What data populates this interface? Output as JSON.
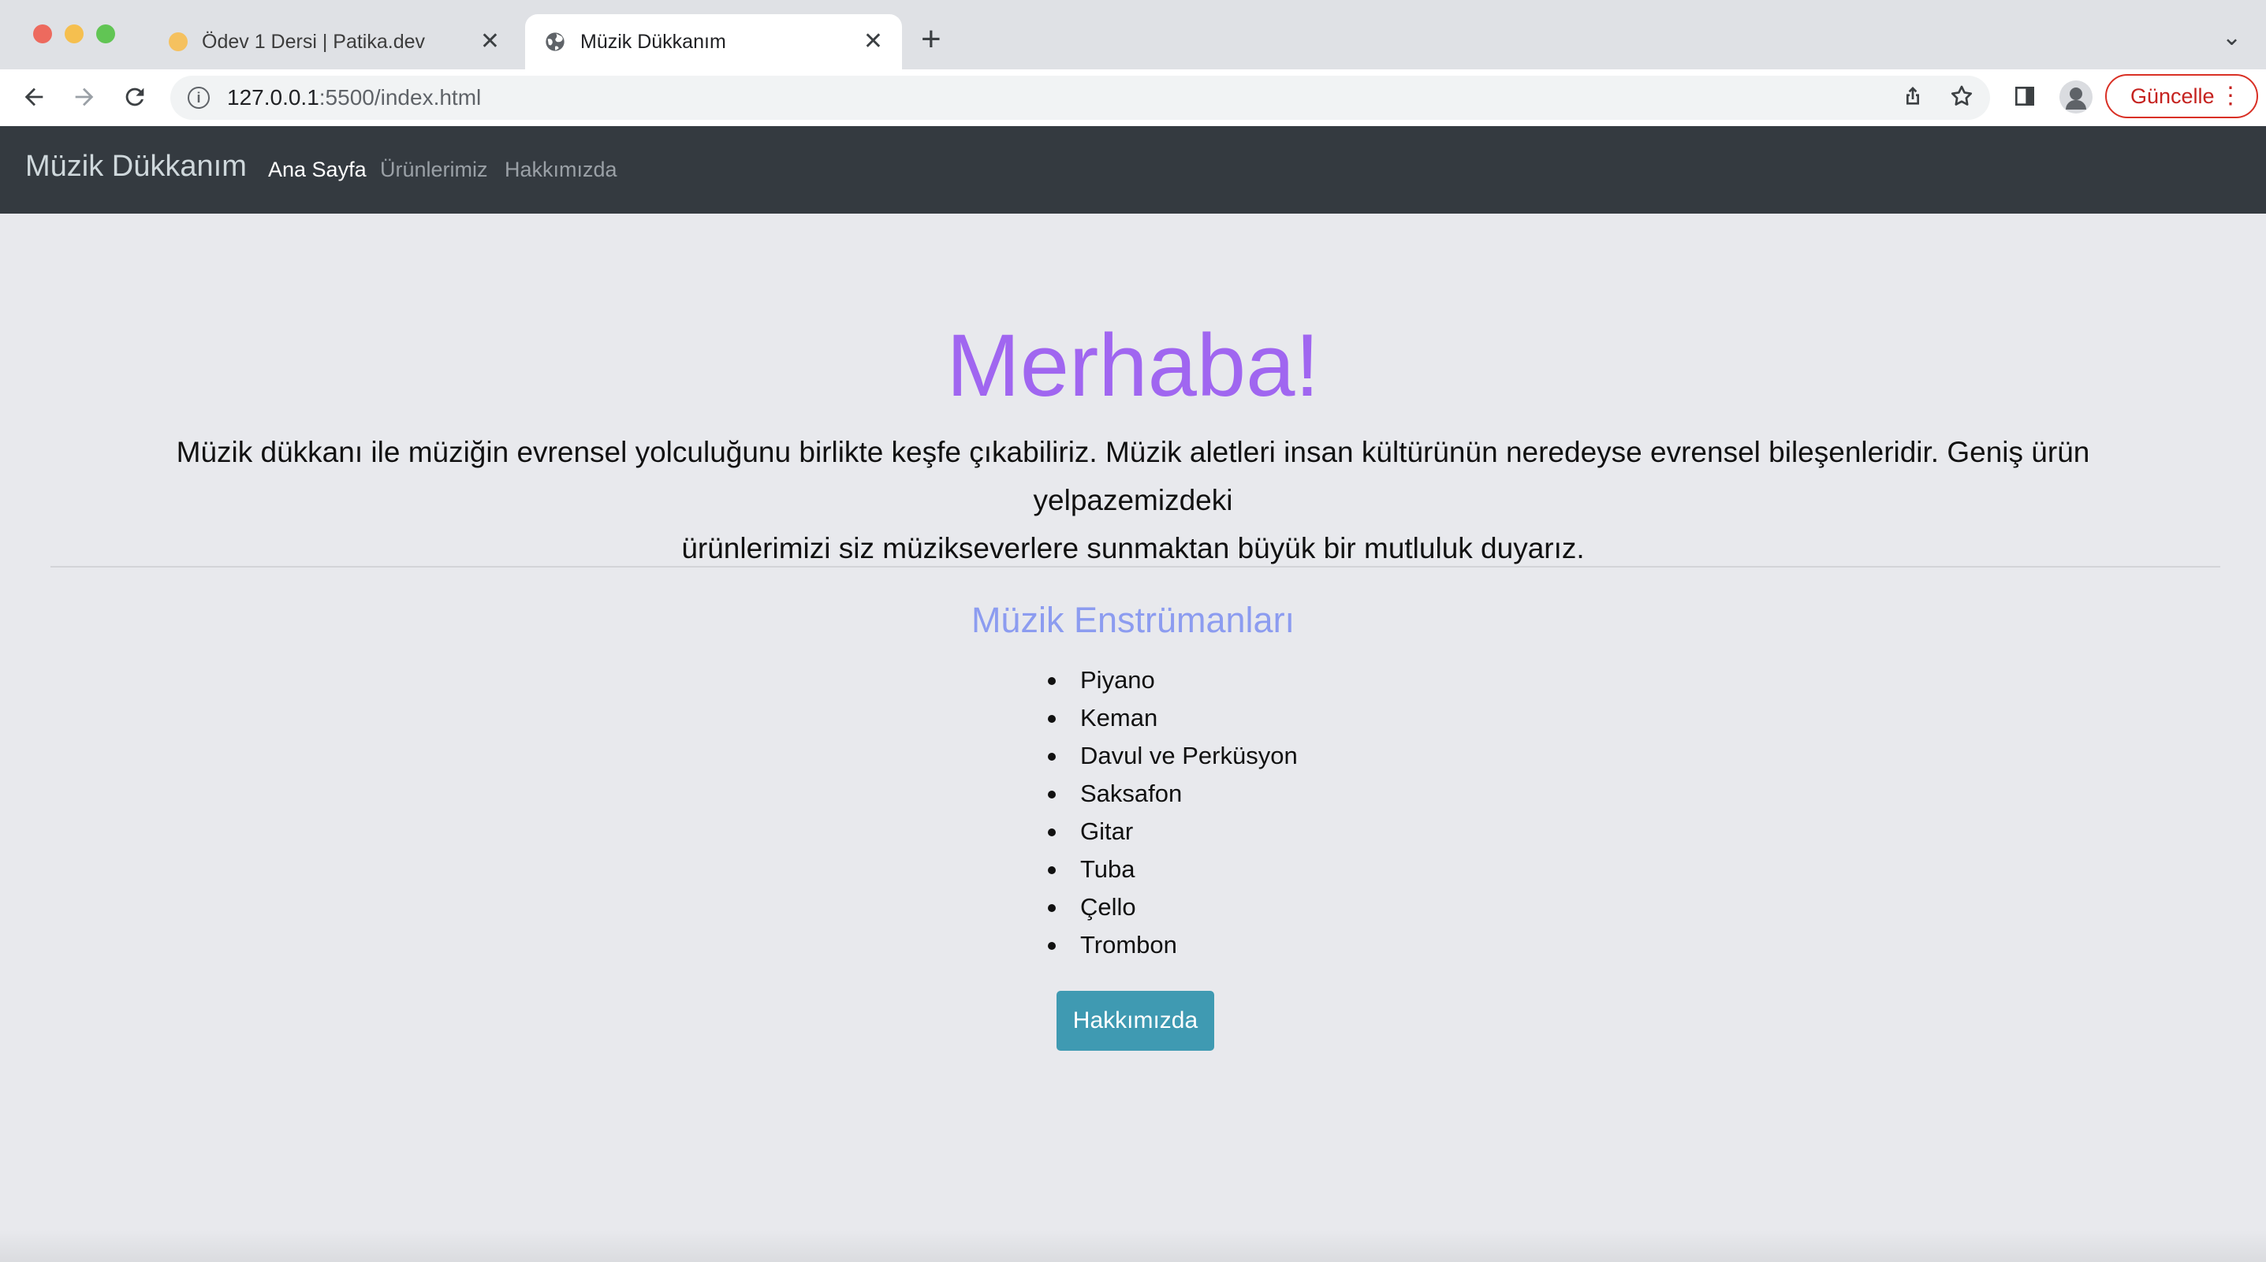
{
  "browser": {
    "tabs": [
      {
        "title": "Ödev 1 Dersi | Patika.dev",
        "active": false,
        "icon": "patika-favicon-icon"
      },
      {
        "title": "Müzik Dükkanım",
        "active": true,
        "icon": "globe-icon"
      }
    ],
    "url_host": "127.0.0.1",
    "url_rest": ":5500/index.html",
    "update_label": "Güncelle"
  },
  "navbar": {
    "brand": "Müzik Dükkanım",
    "links": [
      {
        "label": "Ana Sayfa",
        "active": true
      },
      {
        "label": "Ürünlerimiz",
        "active": false
      },
      {
        "label": "Hakkımızda",
        "active": false
      }
    ]
  },
  "hero": {
    "title": "Merhaba!",
    "text_line1": "Müzik dükkanı ile müziğin evrensel yolculuğunu birlikte keşfe çıkabiliriz. Müzik aletleri insan kültürünün neredeyse evrensel bileşenleridir. Geniş ürün yelpazemizdeki",
    "text_line2": "ürünlerimizi siz müzikseverlere sunmaktan büyük bir mutluluk duyarız."
  },
  "instruments": {
    "title": "Müzik Enstrümanları",
    "items": [
      "Piyano",
      "Keman",
      "Davul ve Perküsyon",
      "Saksafon",
      "Gitar",
      "Tuba",
      "Çello",
      "Trombon"
    ]
  },
  "about_button": "Hakkımızda",
  "colors": {
    "navbar": "#343a40",
    "hero_title": "#a066f0",
    "section_title": "#8c9cf0",
    "button": "#3f9ab2",
    "page_bg": "#e8e9ed"
  }
}
